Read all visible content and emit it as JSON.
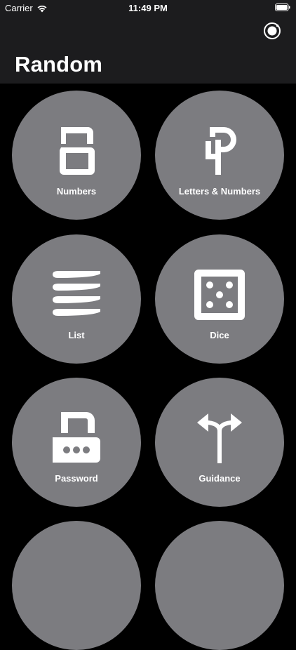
{
  "status_bar": {
    "carrier": "Carrier",
    "time": "11:49 PM",
    "wifi_icon": "wifi-icon",
    "battery_icon": "battery-icon"
  },
  "nav": {
    "title": "Random",
    "settings_icon": "gear-icon"
  },
  "tiles": [
    {
      "label": "Numbers",
      "icon": "digit-eight-icon"
    },
    {
      "label": "Letters & Numbers",
      "icon": "letter-p-digit-four-icon"
    },
    {
      "label": "List",
      "icon": "list-lines-icon"
    },
    {
      "label": "Dice",
      "icon": "dice-five-icon"
    },
    {
      "label": "Password",
      "icon": "padlock-icon"
    },
    {
      "label": "Guidance",
      "icon": "split-arrow-icon"
    }
  ],
  "colors": {
    "background": "#000000",
    "nav_background": "#1c1c1e",
    "tile": "#7c7c80",
    "text": "#ffffff"
  }
}
